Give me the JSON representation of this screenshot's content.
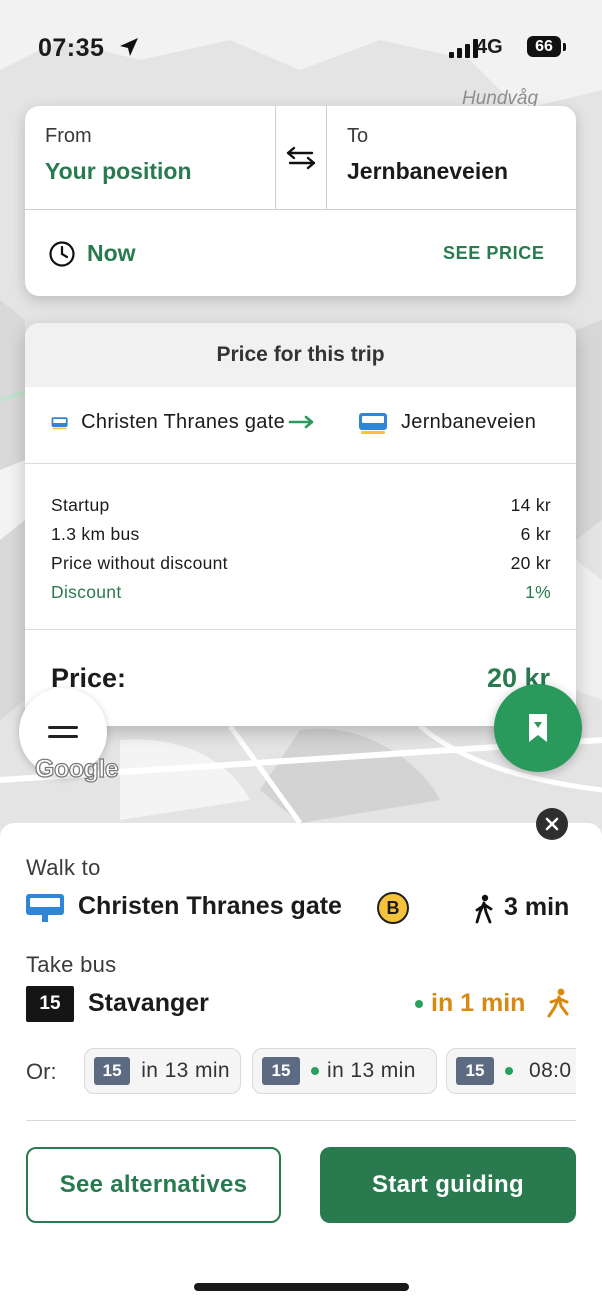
{
  "status_bar": {
    "time": "07:35",
    "network": "4G",
    "battery": "66"
  },
  "map": {
    "place_label": "Hundvåg",
    "attribution": "Google"
  },
  "search": {
    "from_label": "From",
    "from_value": "Your position",
    "to_label": "To",
    "to_value": "Jernbaneveien",
    "time_value": "Now",
    "see_price": "SEE PRICE"
  },
  "price_card": {
    "title": "Price for this trip",
    "from_stop": "Christen Thranes gate",
    "to_stop": "Jernbaneveien",
    "fees": [
      {
        "label": "Startup",
        "value": "14 kr"
      },
      {
        "label": "1.3 km bus",
        "value": "6 kr"
      },
      {
        "label": "Price without discount",
        "value": "20 kr"
      },
      {
        "label": "Discount",
        "value": "1%"
      }
    ],
    "total_label": "Price:",
    "total_value": "20 kr"
  },
  "trip": {
    "walk_label": "Walk to",
    "stop_name": "Christen Thranes gate",
    "platform": "B",
    "walk_time": "3 min",
    "take_label": "Take bus",
    "line": "15",
    "destination": "Stavanger",
    "departure": "in 1 min",
    "or_label": "Or:",
    "alternatives": [
      {
        "line": "15",
        "time": "in 13 min",
        "realtime": false
      },
      {
        "line": "15",
        "time": "in 13 min",
        "realtime": true
      },
      {
        "line": "15",
        "time": "08:0",
        "realtime": true
      }
    ]
  },
  "actions": {
    "see_alternatives": "See alternatives",
    "start_guiding": "Start guiding"
  },
  "colors": {
    "brand_green": "#2a7a4f",
    "fab_green": "#2a9a5c",
    "departure_orange": "#d88a10",
    "platform_yellow": "#f5c33b"
  }
}
